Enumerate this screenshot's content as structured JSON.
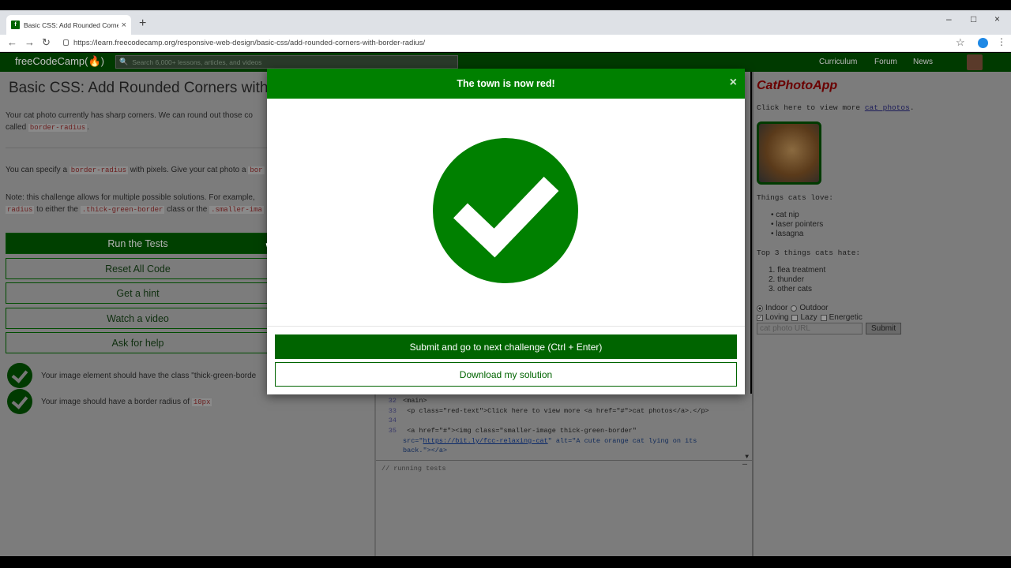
{
  "browser": {
    "tab_title": "Basic CSS: Add Rounded Corners",
    "tab_close": "×",
    "new_tab": "+",
    "url": "https://learn.freecodecamp.org/responsive-web-design/basic-css/add-rounded-corners-with-border-radius/",
    "window_controls": [
      "–",
      "□",
      "×"
    ]
  },
  "navbar": {
    "brand": "freeCodeCamp(🔥)",
    "search_placeholder": "Search 6,000+ lessons, articles, and videos",
    "links": [
      "Curriculum",
      "Forum",
      "News"
    ]
  },
  "lesson": {
    "title": "Basic CSS: Add Rounded Corners with",
    "p1_a": "Your cat photo currently has sharp corners. We can round out those co",
    "p1_b": "called ",
    "p1_code": "border-radius",
    "p1_end": ".",
    "p2_a": "You can specify a ",
    "p2_code1": "border-radius",
    "p2_b": " with pixels. Give your cat photo a ",
    "p2_code2": "bor",
    "p3_a": "Note: this challenge allows for multiple possible solutions. For example,",
    "p3_code1": "radius",
    "p3_b": " to either the ",
    "p3_code2": ".thick-green-border",
    "p3_c": " class or the ",
    "p3_code3": ".smaller-ima",
    "buttons": {
      "run": "Run the Tests",
      "reset": "Reset All Code",
      "hint": "Get a hint",
      "video": "Watch a video",
      "help": "Ask for help"
    },
    "tests": [
      {
        "text": "Your image element should have the class \"thick-green-borde"
      },
      {
        "text": "Your image should have a border radius of ",
        "code": "10px"
      }
    ]
  },
  "editor": {
    "lines": [
      {
        "num": "32",
        "text": "<main>"
      },
      {
        "num": "33",
        "text": "  <p class=\"red-text\">Click here to view more <a href=\"#\">cat photos</a>.</p>"
      },
      {
        "num": "34",
        "text": ""
      },
      {
        "num": "35",
        "text": "  <a href=\"#\"><img class=\"smaller-image thick-green-border\""
      },
      {
        "num": "",
        "text_a": "src=\"",
        "link": "https://bit.ly/fcc-relaxing-cat",
        "text_b": "\" alt=\"A cute orange cat lying on its"
      },
      {
        "num": "",
        "text": "back.\"></a>"
      }
    ],
    "output": "// running tests",
    "output_min": "—"
  },
  "preview": {
    "title": "CatPhotoApp",
    "click_text": "Click here to view more ",
    "click_link": "cat photos",
    "click_end": ".",
    "loves_title": "Things cats love:",
    "loves": [
      "cat nip",
      "laser pointers",
      "lasagna"
    ],
    "hates_title": "Top 3 things cats hate:",
    "hates": [
      "flea treatment",
      "thunder",
      "other cats"
    ],
    "radios": [
      "Indoor",
      "Outdoor"
    ],
    "checks": [
      "Loving",
      "Lazy",
      "Energetic"
    ],
    "url_placeholder": "cat photo URL",
    "submit": "Submit"
  },
  "modal": {
    "title": "The town is now red!",
    "close": "×",
    "submit_button": "Submit and go to next challenge (Ctrl + Enter)",
    "download_button": "Download my solution"
  },
  "colors": {
    "fcc_green": "#008000",
    "fcc_dark_green": "#006400"
  }
}
